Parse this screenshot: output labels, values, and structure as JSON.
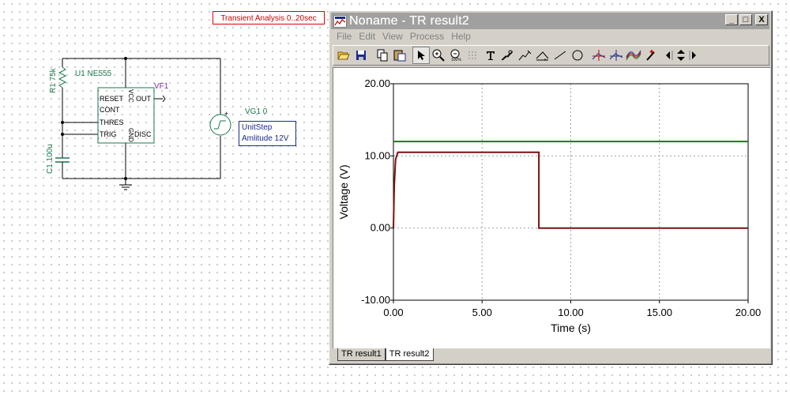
{
  "schematic": {
    "analysis_label": "Transient Analysis 0..20sec",
    "r1_label": "R1 75k",
    "u1_label": "U1 NE555",
    "c1_label": "C1 100u",
    "vf1_label": "VF1",
    "vg1_label": "VG1 0",
    "plus_sign": "+",
    "pins": {
      "reset": "RESET",
      "cont": "CONT",
      "thres": "THRES",
      "trig": "TRIG",
      "vcc": "VCC",
      "gnd": "GND",
      "out": "OUT",
      "disc": "DISC"
    },
    "source_box": {
      "line1": "UnitStep",
      "line2": "Amlitude 12V"
    }
  },
  "window": {
    "title": "Noname - TR result2",
    "buttons": {
      "minimize": "_",
      "maximize": "□",
      "close": "X"
    },
    "menu": [
      "File",
      "Edit",
      "View",
      "Process",
      "Help"
    ],
    "toolbar_icons": [
      "open-icon",
      "save-icon",
      "copy-icon",
      "paste-icon",
      "pointer-icon",
      "zoom-in-icon",
      "zoom-100-icon",
      "grid-icon",
      "text-icon",
      "cursor-a-icon",
      "cursor-b-icon",
      "cursor-c-icon",
      "line-icon",
      "ellipse-icon",
      "cursor-red-icon",
      "cursor-blue-icon",
      "curves-icon",
      "pen-icon",
      "arrows-icon"
    ],
    "tabs": [
      "TR result1",
      "TR result2"
    ],
    "active_tab": 1
  },
  "chart_data": {
    "type": "line",
    "xlabel": "Time (s)",
    "ylabel": "Voltage (V)",
    "xlim": [
      0,
      20
    ],
    "ylim": [
      -10,
      20
    ],
    "x_ticks": [
      "0.00",
      "5.00",
      "10.00",
      "15.00",
      "20.00"
    ],
    "y_ticks": [
      "-10.00",
      "0.00",
      "10.00",
      "20.00"
    ],
    "grid": true,
    "series": [
      {
        "color": "#1a7a1a",
        "points": [
          [
            0,
            12
          ],
          [
            20,
            12
          ]
        ]
      },
      {
        "color": "#7a1010",
        "points": [
          [
            0,
            0
          ],
          [
            0.05,
            6
          ],
          [
            0.12,
            9.5
          ],
          [
            0.25,
            10.5
          ],
          [
            8.2,
            10.5
          ],
          [
            8.2,
            0
          ],
          [
            20,
            0
          ]
        ]
      }
    ]
  }
}
